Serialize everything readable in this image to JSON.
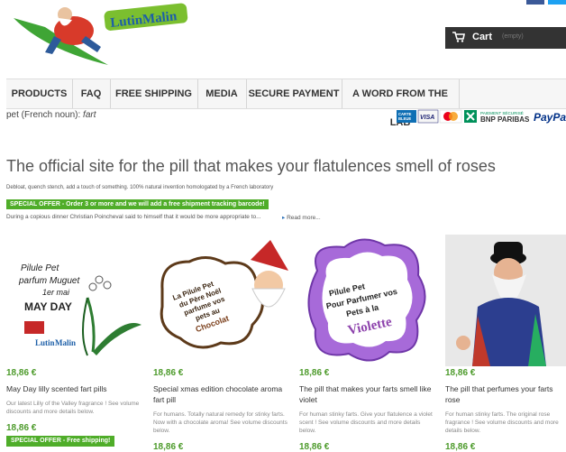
{
  "brand": {
    "name": "LutinMalin"
  },
  "cart": {
    "label": "Cart",
    "status": "(empty)"
  },
  "nav": {
    "items": [
      "PRODUCTS",
      "FAQ",
      "FREE SHIPPING",
      "MEDIA",
      "SECURE PAYMENT",
      "A WORD FROM THE LAB"
    ]
  },
  "definition": {
    "prefix": "pet (French noun):",
    "word": "fart"
  },
  "payment": {
    "cards": [
      "CARTE BLEUE",
      "VISA",
      "MasterCard"
    ],
    "bank_line1": "PAIEMENT SÉCURISÉ",
    "bank_line2": "BNP PARIBAS",
    "paypal": "PayPal"
  },
  "hero": {
    "title": "The official site for the pill that makes your flatulences smell of roses",
    "subtitle": "Debloat, quench stench, add a touch of something. 100% natural invention homologated by a French laboratory",
    "offer": "SPECIAL OFFER - Order 3 or more and we will add a free shipment tracking barcode!",
    "intro": "During a copious dinner Christian Poincheval said to himself that it would be more appropriate to...",
    "read_more": "Read more..."
  },
  "products": [
    {
      "image_text": [
        "Pilule Pet",
        "parfum Muguet",
        "1er mai",
        "MAY DAY",
        "Lutin",
        "Malin"
      ],
      "price": "18,86 €",
      "name": "May Day lilly scented fart pills",
      "desc": "Our latest Lilly of the Valley fragrance ! See volume discounts and more details below.",
      "price2": "18,86 €",
      "sale": "SPECIAL OFFER - Free shipping!"
    },
    {
      "image_text": [
        "La Pilule Pet",
        "du Père Noël",
        "parfume vos",
        "pets au",
        "Chocolat"
      ],
      "price": "18,86 €",
      "name": "Special xmas edition chocolate aroma fart pill",
      "desc": "For humans. Totally natural remedy for stinky farts. Now with a chocolate aroma! See volume discounts below.",
      "price2": "18,86 €"
    },
    {
      "image_text": [
        "Pilule Pet",
        "Pour Parfumer vos",
        "Pets à la",
        "Violette"
      ],
      "price": "18,86 €",
      "name": "The pill that makes your farts smell like violet",
      "desc": "For human stinky farts. Give your flatulence a violet scent ! See volume discounts and more details below.",
      "price2": "18,86 €"
    },
    {
      "price": "18,86 €",
      "name": "The pill that perfumes your farts rose",
      "desc": "For human stinky farts. The original rose fragrance ! See volume discounts and more details below.",
      "price2": "18,86 €"
    }
  ],
  "colors": {
    "green": "#4fad29",
    "price_green": "#4c9a2a",
    "violet": "#9b59d6",
    "dark": "#333333"
  }
}
